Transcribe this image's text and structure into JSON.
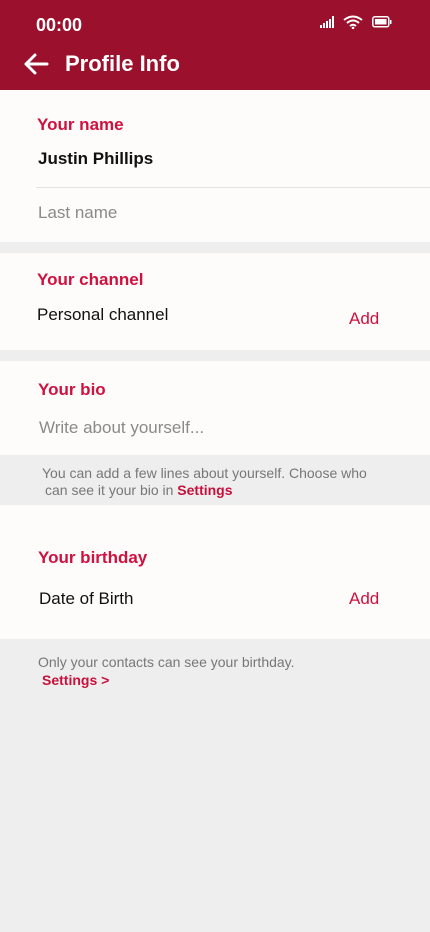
{
  "status_bar": {
    "time": "00:00"
  },
  "header": {
    "title": "Profile Info"
  },
  "name_section": {
    "label": "Your name",
    "first_name": "Justin Phillips",
    "last_name_placeholder": "Last name"
  },
  "channel_section": {
    "label": "Your channel",
    "value": "Personal channel",
    "add_label": "Add"
  },
  "bio_section": {
    "label": "Your bio",
    "placeholder": "Write about yourself...",
    "note_line1": "You can add a few lines about yourself. Choose who",
    "note_line2_prefix": "can see it your bio in",
    "note_link": "Settings"
  },
  "birthday_section": {
    "label": "Your birthday",
    "value": "Date of Birth",
    "add_label": "Add",
    "note": "Only your contacts can see your birthday.",
    "note_link": "Settings >"
  },
  "colors": {
    "accent": "#d0103f",
    "header_bg": "#9b102c"
  }
}
